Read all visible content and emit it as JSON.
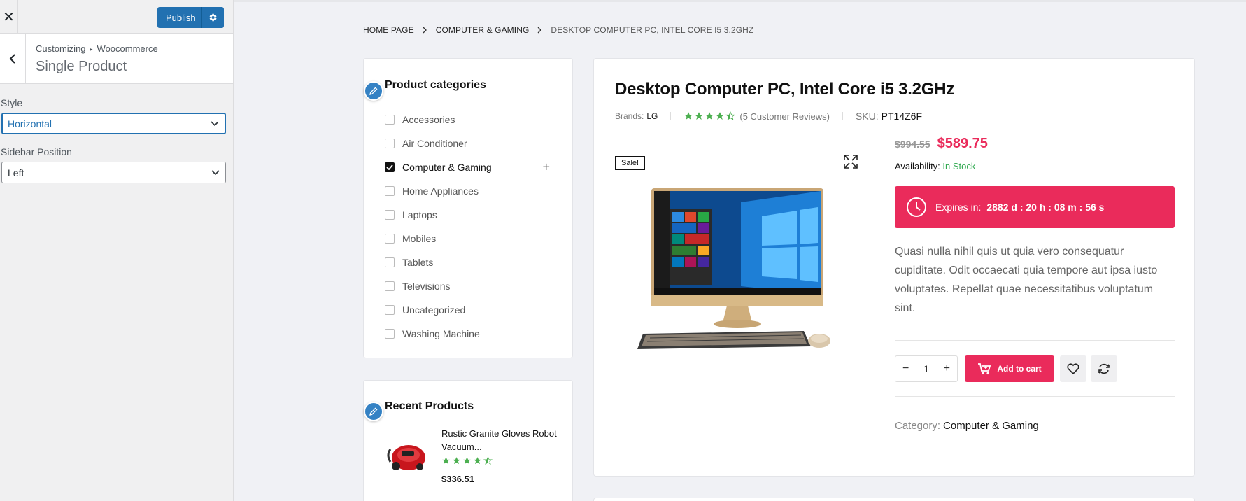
{
  "customizer": {
    "close_glyph": "✕",
    "publish_label": "Publish",
    "breadcrumb_root": "Customizing",
    "breadcrumb_arrow": "▸",
    "breadcrumb_section": "Woocommerce",
    "section_title": "Single Product",
    "controls": {
      "style": {
        "label": "Style",
        "value": "Horizontal"
      },
      "sidebar_position": {
        "label": "Sidebar Position",
        "value": "Left"
      }
    }
  },
  "preview": {
    "breadcrumb": {
      "home": "HOME PAGE",
      "category": "COMPUTER & GAMING",
      "current": "DESKTOP COMPUTER PC, INTEL CORE I5 3.2GHZ"
    },
    "categories_widget": {
      "title": "Product categories",
      "items": [
        {
          "label": "Accessories",
          "checked": false
        },
        {
          "label": "Air Conditioner",
          "checked": false
        },
        {
          "label": "Computer & Gaming",
          "checked": true,
          "expand": "+"
        },
        {
          "label": "Home Appliances",
          "checked": false
        },
        {
          "label": "Laptops",
          "checked": false
        },
        {
          "label": "Mobiles",
          "checked": false
        },
        {
          "label": "Tablets",
          "checked": false
        },
        {
          "label": "Televisions",
          "checked": false
        },
        {
          "label": "Uncategorized",
          "checked": false
        },
        {
          "label": "Washing Machine",
          "checked": false
        }
      ]
    },
    "recent_widget": {
      "title": "Recent Products",
      "items": [
        {
          "name": "Rustic Granite Gloves Robot Vacuum...",
          "rating": 4.5,
          "price": "$336.51"
        }
      ]
    },
    "product": {
      "title": "Desktop Computer PC, Intel Core i5 3.2GHz",
      "brands_label": "Brands:",
      "brand": "LG",
      "rating": 4.5,
      "reviews": "(5 Customer Reviews)",
      "sku_label": "SKU:",
      "sku": "PT14Z6F",
      "sale_badge": "Sale!",
      "old_price": "$994.55",
      "new_price": "$589.75",
      "availability_label": "Availability:",
      "availability_value": "In Stock",
      "expires_label": "Expires in:",
      "expires_value": "2882 d : 20 h : 08 m : 56 s",
      "description": "Quasi nulla nihil quis ut quia vero consequatur cupiditate. Odit occaecati quia tempore aut ipsa iusto voluptates. Repellat quae necessitatibus voluptatum sint.",
      "quantity": "1",
      "qty_minus": "−",
      "qty_plus": "+",
      "add_to_cart": "Add to cart",
      "category_label": "Category:",
      "category_value": "Computer & Gaming"
    }
  },
  "colors": {
    "accent": "#ea2b5b",
    "wp_blue": "#2271b1",
    "star_green": "#4caf50",
    "stock_green": "#2fa84f"
  },
  "icons": [
    "close-icon",
    "gear-icon",
    "back-arrow-icon",
    "chevron-down-icon",
    "chevron-right-icon",
    "pencil-icon",
    "checkmark-icon",
    "plus-icon",
    "star-icon",
    "expand-icon",
    "clock-icon",
    "cart-icon",
    "heart-icon",
    "compare-icon"
  ]
}
